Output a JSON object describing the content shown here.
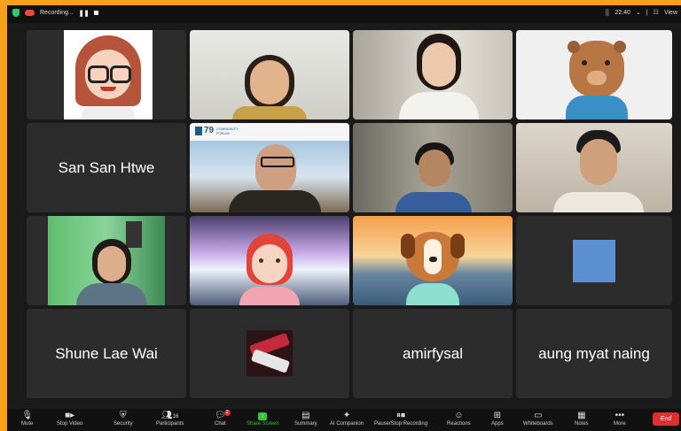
{
  "topbar": {
    "recording_label": "Recording...",
    "time": "22:40",
    "view_label": "View"
  },
  "tiles": {
    "t1": {
      "kind": "avatar-cartoon-woman"
    },
    "t2": {
      "kind": "video-person"
    },
    "t3": {
      "kind": "video-person"
    },
    "t4": {
      "kind": "avatar-bear"
    },
    "t5": {
      "name": "San San Htwe"
    },
    "t6": {
      "kind": "video-person",
      "banner": "79",
      "banner_sub": "COMMUNITY FORUM"
    },
    "t7": {
      "kind": "video-person"
    },
    "t8": {
      "kind": "video-person"
    },
    "t9": {
      "kind": "video-person"
    },
    "t10": {
      "kind": "avatar-redhair"
    },
    "t11": {
      "kind": "avatar-dog"
    },
    "t12": {
      "kind": "blue-square"
    },
    "t13": {
      "name": "Shune Lae Wai"
    },
    "t14": {
      "kind": "profile-picture"
    },
    "t15": {
      "name": "amirfysal"
    },
    "t16": {
      "name": "aung myat naing"
    }
  },
  "toolbar": {
    "mute": "Mute",
    "stop_video": "Stop Video",
    "security": "Security",
    "participants": "Participants",
    "participants_count": "16",
    "chat": "Chat",
    "chat_badge": "2",
    "share_screen": "Share Screen",
    "summary": "Summary",
    "ai_companion": "AI Companion",
    "pause_stop_recording": "Pause/Stop Recording",
    "reactions": "Reactions",
    "apps": "Apps",
    "whiteboards": "Whiteboards",
    "notes": "Notes",
    "more": "More",
    "end": "End"
  }
}
